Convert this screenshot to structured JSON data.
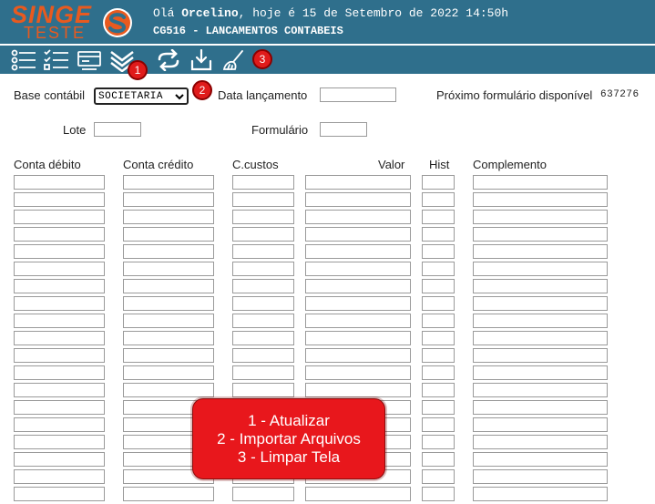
{
  "header": {
    "logo_top": "SINGE",
    "logo_bottom": "TESTE",
    "greeting_prefix": "Olá ",
    "user": "Orcelino",
    "greeting_suffix": ", hoje é 15 de Setembro de 2022 14:50h",
    "screen_title": "CG516 - LANCAMENTOS CONTABEIS"
  },
  "toolbar": {
    "badges": [
      "1",
      "2",
      "3"
    ]
  },
  "form": {
    "base_label": "Base contábil",
    "base_value": "SOCIETARIA",
    "data_label": "Data lançamento",
    "data_value": "",
    "next_form_label": "Próximo formulário disponível",
    "next_form_value": "637276",
    "lote_label": "Lote",
    "lote_value": "",
    "formulario_label": "Formulário",
    "formulario_value": ""
  },
  "grid": {
    "columns": [
      "Conta débito",
      "Conta crédito",
      "C.custos",
      "Valor",
      "Hist",
      "Complemento"
    ],
    "rows": 19
  },
  "callout": {
    "lines": [
      "1 - Atualizar",
      "2 - Importar Arquivos",
      "3 - Limpar Tela"
    ]
  },
  "colors": {
    "header_bg": "#2f6f8c",
    "logo": "#e85a1f",
    "badge": "#e01b1b",
    "callout": "#e8171c"
  }
}
